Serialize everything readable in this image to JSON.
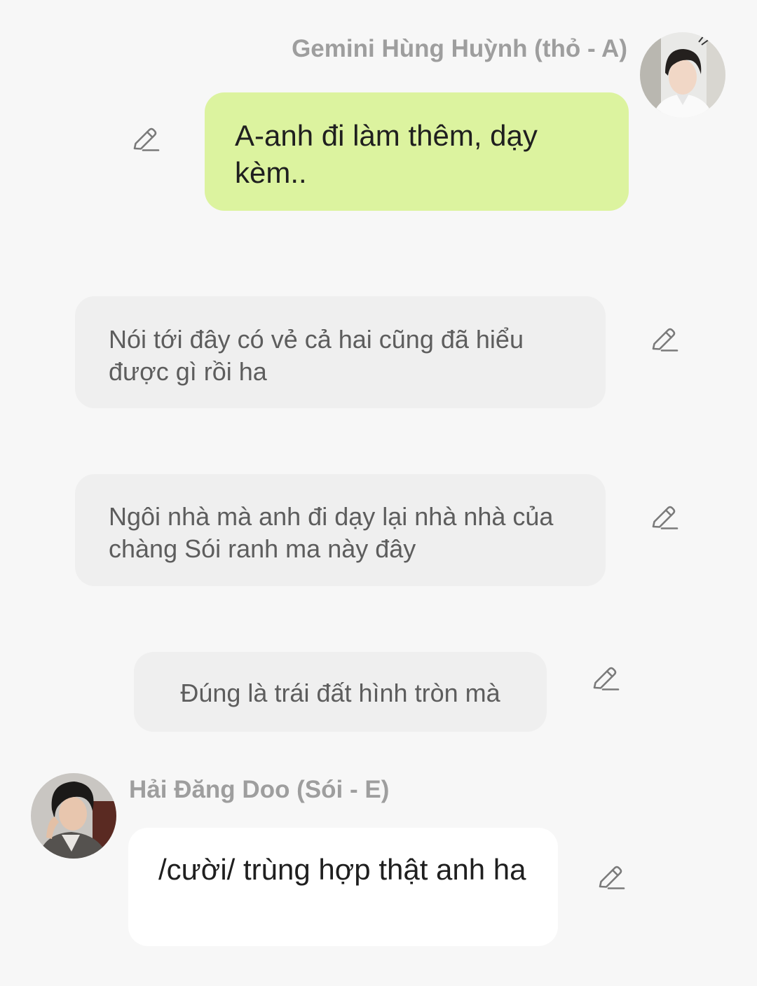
{
  "messages": [
    {
      "sender": "Gemini Hùng Huỳnh (thỏ - A)",
      "text": "A-anh đi làm thêm, dạy kèm.."
    },
    {
      "text": "Nói tới đây có vẻ cả hai cũng đã hiểu được gì rồi ha"
    },
    {
      "text": "Ngôi nhà mà anh đi dạy lại nhà nhà của chàng Sói ranh ma này đây"
    },
    {
      "text": "Đúng là trái đất hình tròn mà"
    },
    {
      "sender": "Hải Đăng Doo (Sói - E)",
      "text": "/cười/ trùng hợp thật anh ha"
    }
  ],
  "colors": {
    "background": "#f7f7f7",
    "own_bubble": "#dcf39f",
    "narration_bubble": "#efefef",
    "other_bubble": "#ffffff",
    "sender_name": "#9e9e9e",
    "icon": "#7a7a7a"
  },
  "icons": {
    "edit": "pencil-edit-icon"
  }
}
